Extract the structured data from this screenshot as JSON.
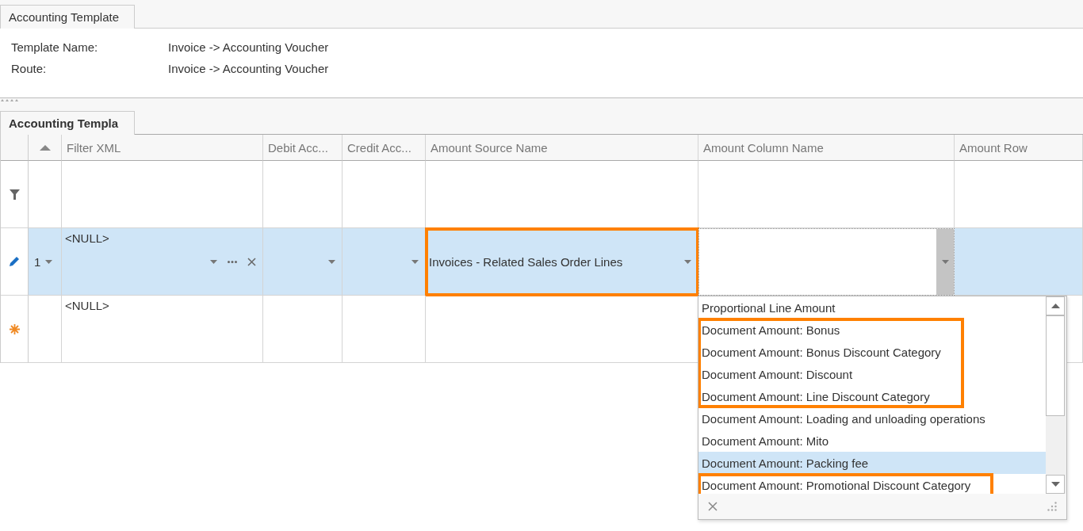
{
  "top_tabs": [
    {
      "label": "Accounting Template",
      "selected": true
    }
  ],
  "fields": [
    {
      "label": "Template Name:",
      "value": "Invoice -> Accounting Voucher"
    },
    {
      "label": "Route:",
      "value": "Invoice -> Accounting Voucher"
    }
  ],
  "grid_tabs": [
    {
      "label": "Accounting Templa",
      "selected": true
    }
  ],
  "grid": {
    "columns": [
      {
        "kind": "sort",
        "sort_ascending": true
      },
      {
        "label": "Filter XML"
      },
      {
        "label": "Debit Acc..."
      },
      {
        "label": "Credit Acc..."
      },
      {
        "label": "Amount Source Name"
      },
      {
        "label": "Amount Column Name"
      },
      {
        "label": "Amount Row"
      }
    ],
    "rows": [
      {
        "kind": "filter"
      },
      {
        "kind": "data",
        "selected": true,
        "editing": true,
        "number": "1",
        "cells": [
          {
            "kind": "lookup",
            "value": "<NULL>"
          },
          {
            "kind": "combo"
          },
          {
            "kind": "combo"
          },
          {
            "kind": "combo",
            "value": "Invoices - Related Sales Order Lines",
            "highlighted": true
          },
          {
            "kind": "active-combo"
          },
          {
            "kind": "plain"
          }
        ]
      },
      {
        "kind": "new",
        "cells": [
          {
            "kind": "plain",
            "value": "<NULL>"
          },
          {
            "kind": "plain"
          },
          {
            "kind": "plain"
          },
          {
            "kind": "plain"
          }
        ]
      }
    ]
  },
  "dropdown": {
    "items": [
      {
        "label": "Proportional Line Amount",
        "selected": false,
        "highlighted": false
      },
      {
        "label": "Document Amount: Bonus",
        "selected": false,
        "highlighted": true
      },
      {
        "label": "Document Amount: Bonus Discount Category",
        "selected": false,
        "highlighted": true
      },
      {
        "label": "Document Amount: Discount",
        "selected": false,
        "highlighted": true
      },
      {
        "label": "Document Amount: Line Discount Category",
        "selected": false,
        "highlighted": true
      },
      {
        "label": "Document Amount: Loading and unloading operations",
        "selected": false,
        "highlighted": false
      },
      {
        "label": "Document Amount: Mito",
        "selected": false,
        "highlighted": false
      },
      {
        "label": "Document Amount: Packing fee",
        "selected": true,
        "highlighted": false
      },
      {
        "label": "Document Amount: Promotional Discount Category",
        "selected": false,
        "highlighted": true
      }
    ]
  }
}
